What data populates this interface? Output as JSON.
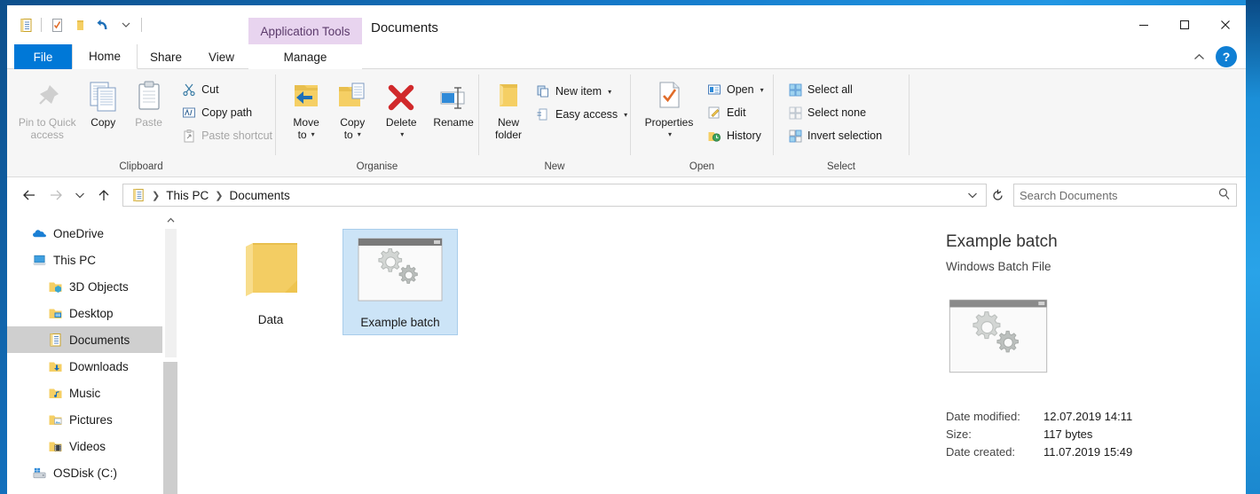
{
  "window": {
    "title": "Documents",
    "contextual_tab": "Application Tools",
    "minimize_icon": "minimize-icon",
    "maximize_icon": "maximize-icon",
    "close_icon": "close-icon",
    "ribbon_collapse_icon": "chevron-up-icon",
    "help_label": "?"
  },
  "quick_access": {
    "items": [
      {
        "name": "documents-icon"
      },
      {
        "name": "properties-icon"
      },
      {
        "name": "new-folder-icon"
      },
      {
        "name": "undo-icon"
      },
      {
        "name": "customize-dropdown-icon"
      }
    ]
  },
  "tabs": [
    {
      "label": "File",
      "id": "file"
    },
    {
      "label": "Home",
      "id": "home"
    },
    {
      "label": "Share",
      "id": "share"
    },
    {
      "label": "View",
      "id": "view"
    },
    {
      "label": "Manage",
      "id": "manage"
    }
  ],
  "ribbon": {
    "groups": [
      {
        "label": "Clipboard",
        "big_buttons": [
          {
            "label": "Pin to Quick\naccess",
            "line1": "Pin to Quick",
            "line2": "access",
            "icon": "pin-icon",
            "disabled": false
          },
          {
            "label": "Copy",
            "line1": "Copy",
            "line2": "",
            "icon": "copy-icon",
            "disabled": false
          },
          {
            "label": "Paste",
            "line1": "Paste",
            "line2": "",
            "icon": "paste-icon",
            "disabled": true
          }
        ],
        "small_buttons": [
          {
            "label": "Cut",
            "icon": "scissors-icon",
            "disabled": false
          },
          {
            "label": "Copy path",
            "icon": "copy-path-icon",
            "disabled": false
          },
          {
            "label": "Paste shortcut",
            "icon": "paste-shortcut-icon",
            "disabled": true
          }
        ]
      },
      {
        "label": "Organise",
        "big_buttons": [
          {
            "line1": "Move",
            "line2": "to",
            "icon": "move-to-icon",
            "has_caret": true
          },
          {
            "line1": "Copy",
            "line2": "to",
            "icon": "copy-to-icon",
            "has_caret": true
          },
          {
            "line1": "Delete",
            "line2": "",
            "icon": "delete-icon",
            "has_caret": true
          },
          {
            "line1": "Rename",
            "line2": "",
            "icon": "rename-icon",
            "has_caret": false
          }
        ]
      },
      {
        "label": "New",
        "big_buttons": [
          {
            "line1": "New",
            "line2": "folder",
            "icon": "new-folder-icon",
            "has_caret": false
          }
        ],
        "small_buttons": [
          {
            "label": "New item",
            "icon": "new-item-icon",
            "has_caret": true
          },
          {
            "label": "Easy access",
            "icon": "easy-access-icon",
            "has_caret": true
          }
        ]
      },
      {
        "label": "Open",
        "big_buttons": [
          {
            "line1": "Properties",
            "line2": "",
            "icon": "properties-icon",
            "has_caret": true
          }
        ],
        "small_buttons": [
          {
            "label": "Open",
            "icon": "open-icon",
            "has_caret": true
          },
          {
            "label": "Edit",
            "icon": "edit-icon",
            "has_caret": false
          },
          {
            "label": "History",
            "icon": "history-icon",
            "has_caret": false
          }
        ]
      },
      {
        "label": "Select",
        "small_buttons": [
          {
            "label": "Select all",
            "icon": "select-all-icon"
          },
          {
            "label": "Select none",
            "icon": "select-none-icon"
          },
          {
            "label": "Invert selection",
            "icon": "invert-selection-icon"
          }
        ]
      }
    ]
  },
  "address_bar": {
    "back_icon": "arrow-left-icon",
    "forward_icon": "arrow-right-icon",
    "recent_icon": "chevron-down-icon",
    "up_icon": "arrow-up-icon",
    "path_icon": "documents-icon",
    "breadcrumbs": [
      "This PC",
      "Documents"
    ],
    "dropdown_icon": "chevron-down-icon",
    "refresh_icon": "refresh-icon"
  },
  "search": {
    "placeholder": "Search Documents",
    "value": "",
    "icon": "search-icon"
  },
  "sidebar": {
    "items": [
      {
        "label": "OneDrive",
        "icon": "onedrive-icon",
        "indent": false,
        "selected": false
      },
      {
        "label": "This PC",
        "icon": "this-pc-icon",
        "indent": false,
        "selected": false
      },
      {
        "label": "3D Objects",
        "icon": "folder-3d-icon",
        "indent": true,
        "selected": false
      },
      {
        "label": "Desktop",
        "icon": "desktop-folder-icon",
        "indent": true,
        "selected": false
      },
      {
        "label": "Documents",
        "icon": "documents-folder-icon",
        "indent": true,
        "selected": true
      },
      {
        "label": "Downloads",
        "icon": "downloads-folder-icon",
        "indent": true,
        "selected": false
      },
      {
        "label": "Music",
        "icon": "music-folder-icon",
        "indent": true,
        "selected": false
      },
      {
        "label": "Pictures",
        "icon": "pictures-folder-icon",
        "indent": true,
        "selected": false
      },
      {
        "label": "Videos",
        "icon": "videos-folder-icon",
        "indent": true,
        "selected": false
      },
      {
        "label": "OSDisk (C:)",
        "icon": "disk-drive-icon",
        "indent": false,
        "selected": false
      }
    ],
    "scroll_up_icon": "chevron-up-icon"
  },
  "files": [
    {
      "name": "Data",
      "type": "folder",
      "icon": "folder-icon",
      "selected": false
    },
    {
      "name": "Example batch",
      "type": "batch",
      "icon": "batch-file-icon",
      "selected": true
    }
  ],
  "details_pane": {
    "title": "Example batch",
    "subtitle": "Windows Batch File",
    "preview_icon": "batch-file-icon",
    "fields": [
      {
        "key": "Date modified:",
        "value": "12.07.2019 14:11"
      },
      {
        "key": "Size:",
        "value": "117 bytes"
      },
      {
        "key": "Date created:",
        "value": "11.07.2019 15:49"
      }
    ]
  },
  "colors": {
    "accent": "#0078d7",
    "selection": "#cce4f7",
    "contextual_tab": "#e8d4ef",
    "folder_yellow": "#f5cf64"
  }
}
